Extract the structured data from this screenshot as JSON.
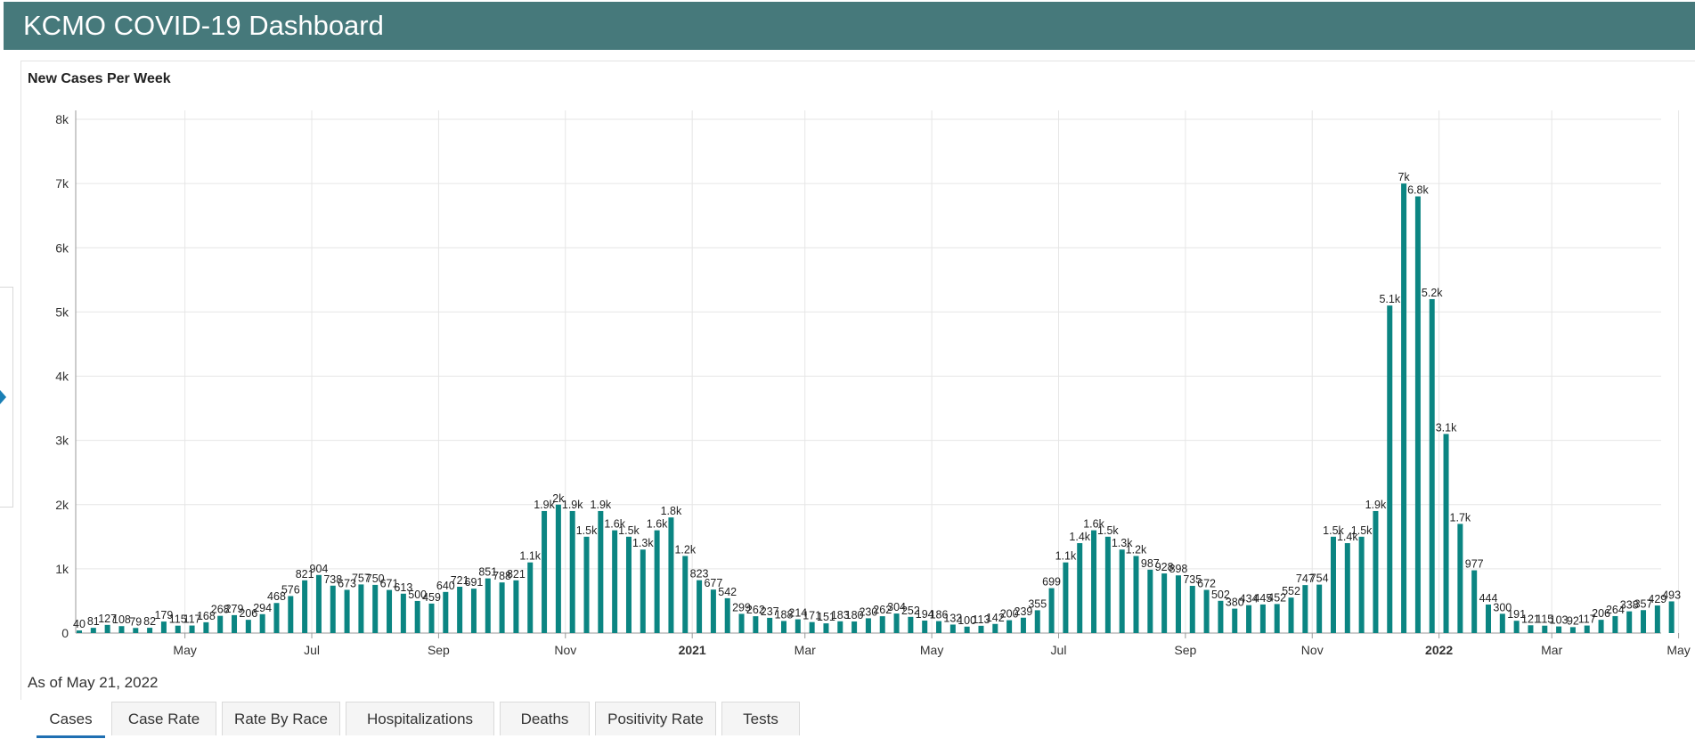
{
  "app": {
    "title": "KCMO COVID-19 Dashboard"
  },
  "footnote": "As of May 21, 2022",
  "tabs": [
    {
      "label": "Cases",
      "active": true
    },
    {
      "label": "Case Rate"
    },
    {
      "label": "Rate By Race"
    },
    {
      "label": "Hospitalizations"
    },
    {
      "label": "Deaths"
    },
    {
      "label": "Positivity Rate"
    },
    {
      "label": "Tests"
    }
  ],
  "colors": {
    "bar": "#0b8582",
    "header": "#46797b",
    "active_tab": "#1f6fb2"
  },
  "chart_data": {
    "type": "bar",
    "title": "New Cases Per Week",
    "xlabel": "",
    "ylabel": "",
    "ylim": [
      0,
      8000
    ],
    "y_ticks": [
      {
        "value": 0,
        "label": "0"
      },
      {
        "value": 1000,
        "label": "1k"
      },
      {
        "value": 2000,
        "label": "2k"
      },
      {
        "value": 3000,
        "label": "3k"
      },
      {
        "value": 4000,
        "label": "4k"
      },
      {
        "value": 5000,
        "label": "5k"
      },
      {
        "value": 6000,
        "label": "6k"
      },
      {
        "value": 7000,
        "label": "7k"
      },
      {
        "value": 8000,
        "label": "8k"
      }
    ],
    "x_ticks": [
      {
        "index": 7.5,
        "label": "May",
        "bold": false
      },
      {
        "index": 16.5,
        "label": "Jul",
        "bold": false
      },
      {
        "index": 25.5,
        "label": "Sep",
        "bold": false
      },
      {
        "index": 34.5,
        "label": "Nov",
        "bold": false
      },
      {
        "index": 43.5,
        "label": "2021",
        "bold": true
      },
      {
        "index": 51.5,
        "label": "Mar",
        "bold": false
      },
      {
        "index": 60.5,
        "label": "May",
        "bold": false
      },
      {
        "index": 69.5,
        "label": "Jul",
        "bold": false
      },
      {
        "index": 78.5,
        "label": "Sep",
        "bold": false
      },
      {
        "index": 87.5,
        "label": "Nov",
        "bold": false
      },
      {
        "index": 96.5,
        "label": "2022",
        "bold": true
      },
      {
        "index": 104.5,
        "label": "Mar",
        "bold": false
      },
      {
        "index": 113.5,
        "label": "May",
        "bold": false
      }
    ],
    "series": [
      {
        "values": [
          40,
          81,
          127,
          108,
          79,
          82,
          179,
          115,
          117,
          168,
          268,
          279,
          206,
          294,
          468,
          576,
          821,
          904,
          738,
          673,
          757,
          750,
          671,
          613,
          500,
          459,
          640,
          721,
          691,
          851,
          788,
          821,
          1100,
          1900,
          2000,
          1900,
          1500,
          1900,
          1600,
          1500,
          1300,
          1600,
          1800,
          1200,
          823,
          677,
          542,
          299,
          262,
          237,
          188,
          214,
          171,
          151,
          183,
          180,
          230,
          262,
          304,
          252,
          194,
          186,
          132,
          100,
          113,
          142,
          200,
          239,
          355,
          699,
          1100,
          1400,
          1600,
          1500,
          1300,
          1200,
          987,
          928,
          898,
          735,
          672,
          502,
          380,
          434,
          445,
          452,
          552,
          747,
          754,
          1500,
          1400,
          1500,
          1900,
          5100,
          7000,
          6800,
          5200,
          3100,
          1700,
          977,
          444,
          300,
          191,
          121,
          115,
          103,
          92,
          117,
          206,
          264,
          338,
          357,
          429,
          493
        ],
        "labels": [
          "40",
          "81",
          "127",
          "108",
          "79",
          "82",
          "179",
          "115",
          "117",
          "168",
          "268",
          "279",
          "206",
          "294",
          "468",
          "576",
          "821",
          "904",
          "738",
          "673",
          "757",
          "750",
          "671",
          "613",
          "500",
          "459",
          "640",
          "721",
          "691",
          "851",
          "788",
          "821",
          "1.1k",
          "1.9k",
          "2k",
          "1.9k",
          "1.5k",
          "1.9k",
          "1.6k",
          "1.5k",
          "1.3k",
          "1.6k",
          "1.8k",
          "1.2k",
          "823",
          "677",
          "542",
          "299",
          "262",
          "237",
          "188",
          "214",
          "171",
          "151",
          "183",
          "180",
          "230",
          "262",
          "304",
          "252",
          "194",
          "186",
          "132",
          "100",
          "113",
          "142",
          "200",
          "239",
          "355",
          "699",
          "1.1k",
          "1.4k",
          "1.6k",
          "1.5k",
          "1.3k",
          "1.2k",
          "987",
          "928",
          "898",
          "735",
          "672",
          "502",
          "380",
          "434",
          "445",
          "452",
          "552",
          "747",
          "754",
          "1.5k",
          "1.4k",
          "1.5k",
          "1.9k",
          "5.1k",
          "7k",
          "6.8k",
          "5.2k",
          "3.1k",
          "1.7k",
          "977",
          "444",
          "300",
          "191",
          "121",
          "115",
          "103",
          "92",
          "117",
          "206",
          "264",
          "338",
          "357",
          "429",
          "493"
        ]
      }
    ],
    "grid": true,
    "legend": "none"
  }
}
